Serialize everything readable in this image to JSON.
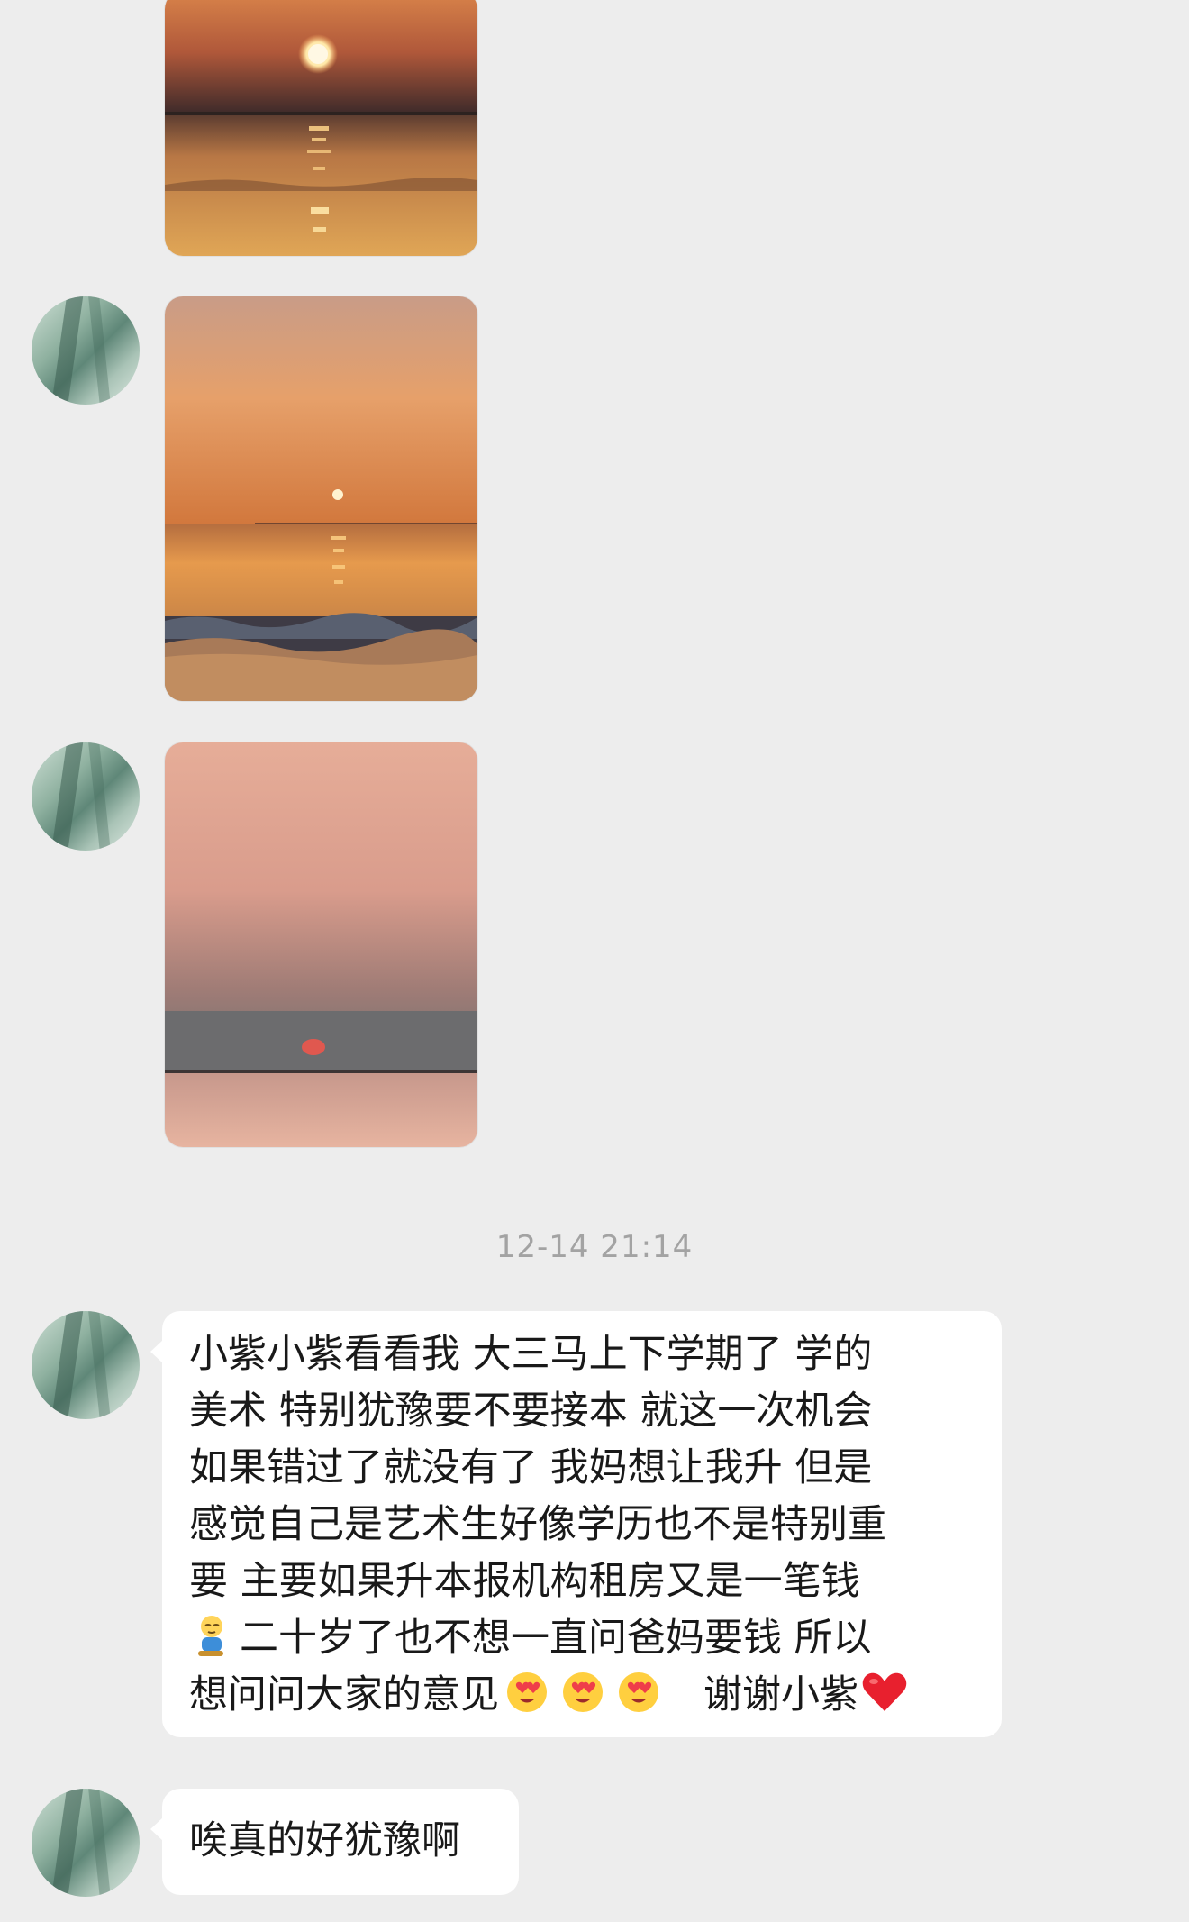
{
  "chat": {
    "timestamp": "12-14 21:14",
    "messages": [
      {
        "type": "text",
        "lines": [
          "小紫小紫看看我   大三马上下学期了   学的",
          "美术   特别犹豫要不要接本   就这一次机会",
          "如果错过了就没有了   我妈想让我升   但是",
          "感觉自己是艺术生好像学历也不是特别重",
          "要   主要如果升本报机构租房又是一笔钱",
          "二十岁了也不想一直问爸妈要钱   所以",
          "想问问大家的意见",
          "谢谢小紫"
        ]
      },
      {
        "type": "text",
        "lines": [
          "唉真的好犹豫啊"
        ]
      }
    ],
    "emojis": [
      "sleepy-boy-emoji",
      "heart-eyes-face-emoji",
      "red-heart-emoji"
    ],
    "colors": {
      "background": "#ededed",
      "bubble": "#ffffff",
      "text": "#191919",
      "timestamp": "#a3a3a3"
    }
  }
}
